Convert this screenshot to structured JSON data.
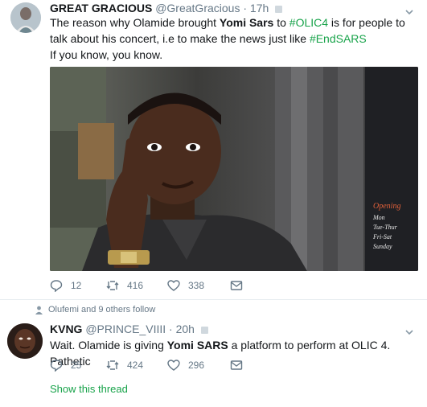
{
  "tweet1": {
    "name": "GREAT GRACIOUS",
    "handle": "@GreatGracious",
    "separator": "·",
    "time": "17h",
    "text_part1": "The reason why Olamide brought ",
    "bold1": "Yomi Sars",
    "text_part2": " to ",
    "hashtag1": "#OLIC4",
    "text_part3": " is for people to talk about his concert, i.e to make the news just like ",
    "hashtag2": "#EndSARS",
    "line2": "If you know, you know.",
    "sign_text": "Opening\nMon\nTue-Thur\nFri-Sat\nSunday",
    "reply_count": "12",
    "retweet_count": "416",
    "like_count": "338"
  },
  "tweet2": {
    "social_context": "Olufemi and 9 others follow",
    "name": "KVNG",
    "handle": "@PRINCE_VIIII",
    "separator": "·",
    "time": "20h",
    "text_part1": "Wait. Olamide is giving ",
    "bold1": "Yomi SARS",
    "text_part2": " a platform to perform at OLIC 4. Pathetic",
    "reply_count": "25",
    "retweet_count": "424",
    "like_count": "296",
    "show_thread": "Show this thread"
  },
  "colors": {
    "hashtag": "#18a34a",
    "secondary_text": "#657786",
    "divider": "#e6ecf0"
  },
  "icons": [
    "reply-icon",
    "retweet-icon",
    "like-icon",
    "dm-icon",
    "caret-down-icon",
    "person-icon"
  ]
}
